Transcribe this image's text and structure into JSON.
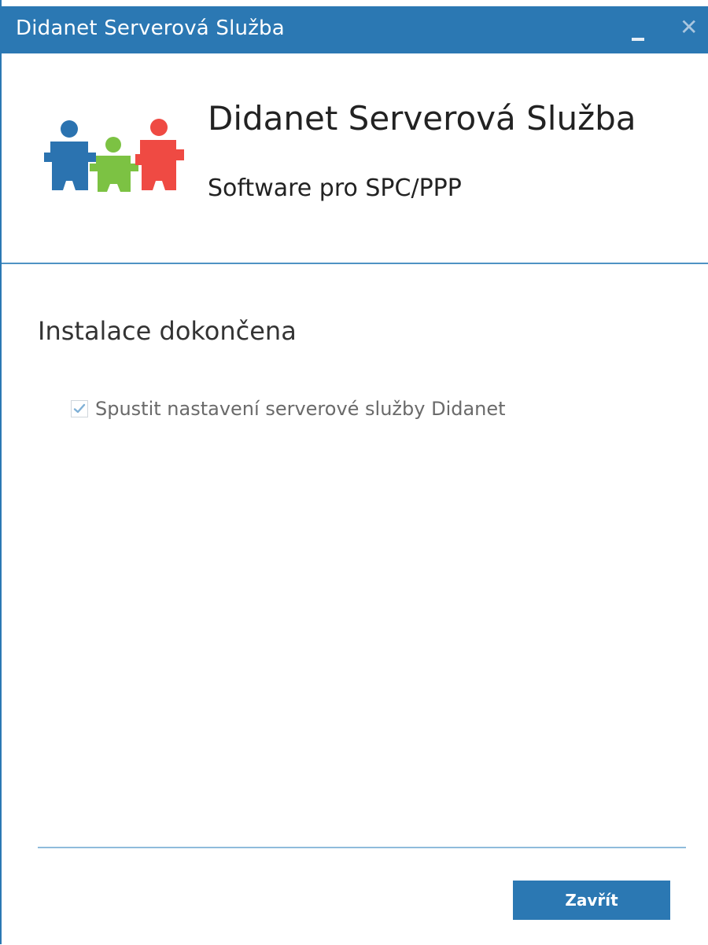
{
  "window": {
    "title": "Didanet Serverová Služba",
    "minimize_icon": "minimize-icon",
    "close_icon": "close-icon",
    "accent_color": "#2b78b3"
  },
  "header": {
    "logo_icon": "puzzle-people-logo",
    "product_title": "Didanet Serverová Služba",
    "product_subtitle": "Software pro SPC/PPP"
  },
  "main": {
    "status_heading": "Instalace dokončena",
    "launch_option": {
      "label": "Spustit nastavení serverové služby Didanet",
      "checked": true
    }
  },
  "footer": {
    "close_button_label": "Zavřít"
  }
}
